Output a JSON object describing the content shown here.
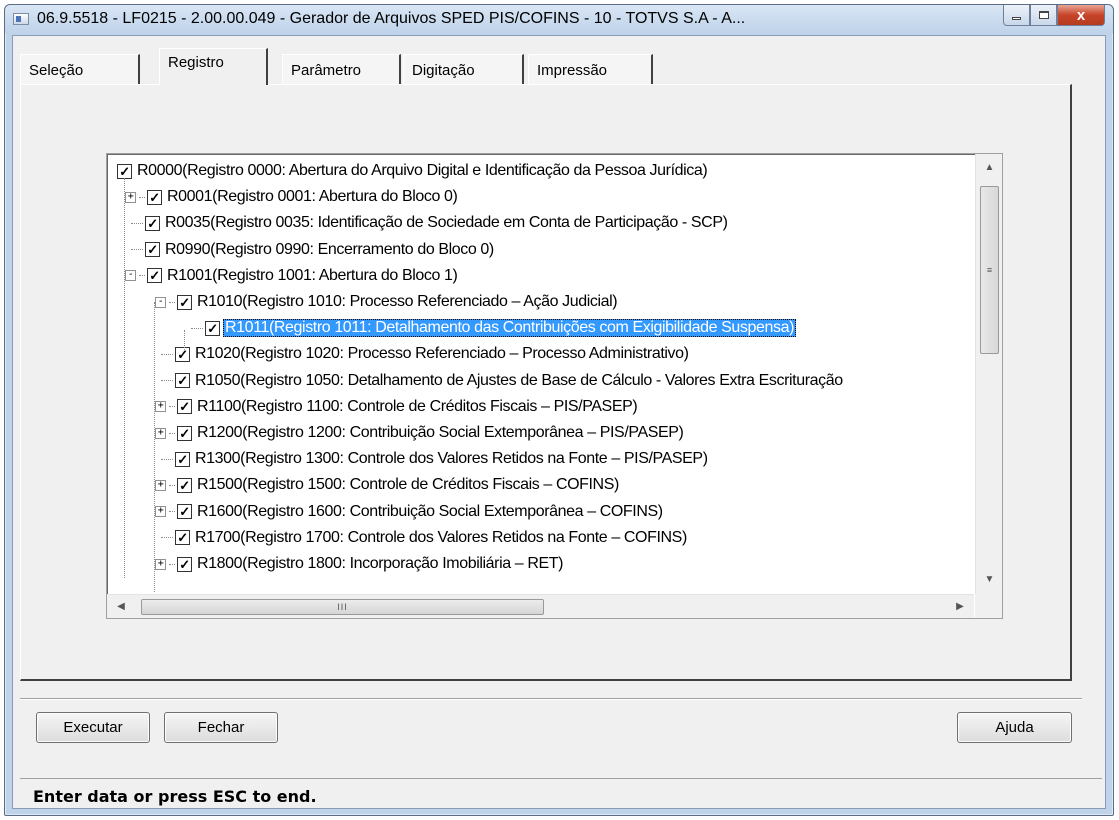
{
  "window": {
    "title": "06.9.5518 - LF0215 - 2.00.00.049 - Gerador de Arquivos SPED PIS/COFINS - 10 - TOTVS S.A - A...",
    "close_glyph": "x"
  },
  "tabs": [
    {
      "label": "Seleção",
      "active": false
    },
    {
      "label": "Registro",
      "active": true
    },
    {
      "label": "Parâmetro",
      "active": false
    },
    {
      "label": "Digitação",
      "active": false
    },
    {
      "label": "Impressão",
      "active": false
    }
  ],
  "tree": {
    "rows": [
      {
        "label": "R0000(Registro 0000: Abertura do Arquivo Digital e Identificação da Pessoa Jurídica)",
        "level": 0,
        "expander": "none",
        "checked": true,
        "selected": false
      },
      {
        "label": "R0001(Registro 0001: Abertura do Bloco 0)",
        "level": 1,
        "expander": "+",
        "checked": true,
        "selected": false
      },
      {
        "label": "R0035(Registro 0035: Identificação de Sociedade em Conta de Participação - SCP)",
        "level": 1,
        "expander": "none",
        "checked": true,
        "selected": false
      },
      {
        "label": "R0990(Registro 0990: Encerramento do Bloco 0)",
        "level": 1,
        "expander": "none",
        "checked": true,
        "selected": false
      },
      {
        "label": "R1001(Registro 1001: Abertura do Bloco 1)",
        "level": 1,
        "expander": "-",
        "checked": true,
        "selected": false
      },
      {
        "label": "R1010(Registro 1010: Processo Referenciado – Ação Judicial)",
        "level": 2,
        "expander": "-",
        "checked": true,
        "selected": false
      },
      {
        "label": "R1011(Registro 1011: Detalhamento das Contribuições com Exigibilidade Suspensa)",
        "level": 3,
        "expander": "none",
        "checked": true,
        "selected": true
      },
      {
        "label": "R1020(Registro 1020: Processo Referenciado – Processo Administrativo)",
        "level": 2,
        "expander": "none",
        "checked": true,
        "selected": false
      },
      {
        "label": "R1050(Registro 1050: Detalhamento de Ajustes de Base de Cálculo - Valores Extra Escrituração",
        "level": 2,
        "expander": "none",
        "checked": true,
        "selected": false
      },
      {
        "label": "R1100(Registro 1100: Controle de Créditos Fiscais – PIS/PASEP)",
        "level": 2,
        "expander": "+",
        "checked": true,
        "selected": false
      },
      {
        "label": "R1200(Registro 1200: Contribuição Social Extemporânea – PIS/PASEP)",
        "level": 2,
        "expander": "+",
        "checked": true,
        "selected": false
      },
      {
        "label": "R1300(Registro 1300: Controle dos Valores Retidos na Fonte – PIS/PASEP)",
        "level": 2,
        "expander": "none",
        "checked": true,
        "selected": false
      },
      {
        "label": "R1500(Registro 1500: Controle de Créditos Fiscais – COFINS)",
        "level": 2,
        "expander": "+",
        "checked": true,
        "selected": false
      },
      {
        "label": "R1600(Registro 1600: Contribuição Social Extemporânea – COFINS)",
        "level": 2,
        "expander": "+",
        "checked": true,
        "selected": false
      },
      {
        "label": "R1700(Registro 1700: Controle dos Valores Retidos na Fonte – COFINS)",
        "level": 2,
        "expander": "none",
        "checked": true,
        "selected": false
      },
      {
        "label": "R1800(Registro 1800: Incorporação Imobiliária – RET)",
        "level": 2,
        "expander": "+",
        "checked": true,
        "selected": false
      }
    ],
    "scroll_thumb_glyph": "≡",
    "hscroll_thumb_glyph": "III"
  },
  "buttons": {
    "executar": "Executar",
    "fechar": "Fechar",
    "ajuda": "Ajuda"
  },
  "status": {
    "text": "Enter data or press ESC to end."
  }
}
